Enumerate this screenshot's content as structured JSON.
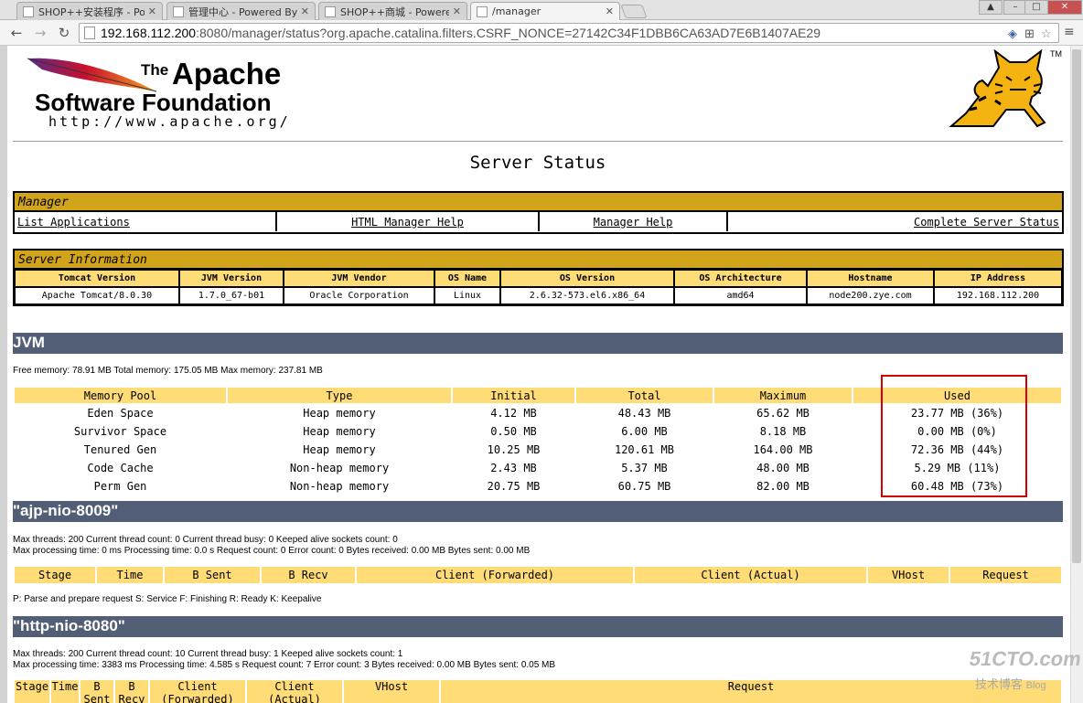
{
  "tabs": [
    {
      "label": "SHOP++安装程序 - Pow"
    },
    {
      "label": "管理中心 - Powered By S"
    },
    {
      "label": "SHOP++商城 - Powered"
    },
    {
      "label": "/manager"
    }
  ],
  "url": {
    "host": "192.168.112.200",
    "rest": ":8080/manager/status?org.apache.catalina.filters.CSRF_NONCE=27142C34F1DBB6CA63AD7E6B1407AE29"
  },
  "logo": {
    "the": "The",
    "apache": "Apache",
    "foundation": "Software Foundation",
    "url": "http://www.apache.org/",
    "tm": "TM"
  },
  "page_title": "Server Status",
  "manager": {
    "heading": "Manager",
    "links": [
      "List Applications",
      "HTML Manager Help",
      "Manager Help",
      "Complete Server Status"
    ]
  },
  "server_info": {
    "heading": "Server Information",
    "headers": [
      "Tomcat Version",
      "JVM Version",
      "JVM Vendor",
      "OS Name",
      "OS Version",
      "OS Architecture",
      "Hostname",
      "IP Address"
    ],
    "values": [
      "Apache Tomcat/8.0.30",
      "1.7.0_67-b01",
      "Oracle Corporation",
      "Linux",
      "2.6.32-573.el6.x86_64",
      "amd64",
      "node200.zye.com",
      "192.168.112.200"
    ]
  },
  "jvm": {
    "heading": "JVM",
    "memory_line": "Free memory: 78.91 MB Total memory: 175.05 MB Max memory: 237.81 MB",
    "headers": [
      "Memory Pool",
      "Type",
      "Initial",
      "Total",
      "Maximum",
      "Used"
    ],
    "rows": [
      [
        "Eden Space",
        "Heap memory",
        "4.12 MB",
        "48.43 MB",
        "65.62 MB",
        "23.77 MB (36%)"
      ],
      [
        "Survivor Space",
        "Heap memory",
        "0.50 MB",
        "6.00 MB",
        "8.18 MB",
        "0.00 MB (0%)"
      ],
      [
        "Tenured Gen",
        "Heap memory",
        "10.25 MB",
        "120.61 MB",
        "164.00 MB",
        "72.36 MB (44%)"
      ],
      [
        "Code Cache",
        "Non-heap memory",
        "2.43 MB",
        "5.37 MB",
        "48.00 MB",
        "5.29 MB (11%)"
      ],
      [
        "Perm Gen",
        "Non-heap memory",
        "20.75 MB",
        "60.75 MB",
        "82.00 MB",
        "60.48 MB (73%)"
      ]
    ]
  },
  "ajp": {
    "heading": "\"ajp-nio-8009\"",
    "line1": "Max threads: 200 Current thread count: 0 Current thread busy: 0 Keeped alive sockets count: 0",
    "line2": "Max processing time: 0 ms Processing time: 0.0 s Request count: 0 Error count: 0 Bytes received: 0.00 MB Bytes sent: 0.00 MB",
    "headers": [
      "Stage",
      "Time",
      "B Sent",
      "B Recv",
      "Client (Forwarded)",
      "Client (Actual)",
      "VHost",
      "Request"
    ],
    "legend": "P: Parse and prepare request S: Service F: Finishing R: Ready K: Keepalive"
  },
  "http": {
    "heading": "\"http-nio-8080\"",
    "line1": "Max threads: 200 Current thread count: 10 Current thread busy: 1 Keeped alive sockets count: 1",
    "line2": "Max processing time: 3383 ms Processing time: 4.585 s Request count: 7 Error count: 3 Bytes received: 0.00 MB Bytes sent: 0.05 MB",
    "headers": [
      "Stage",
      "Time",
      "B Sent",
      "B Recv",
      "Client (Forwarded)",
      "Client (Actual)",
      "VHost",
      "Request"
    ]
  },
  "watermark": {
    "main": "51CTO.com",
    "sub": "技术博客",
    "blog": "Blog"
  }
}
